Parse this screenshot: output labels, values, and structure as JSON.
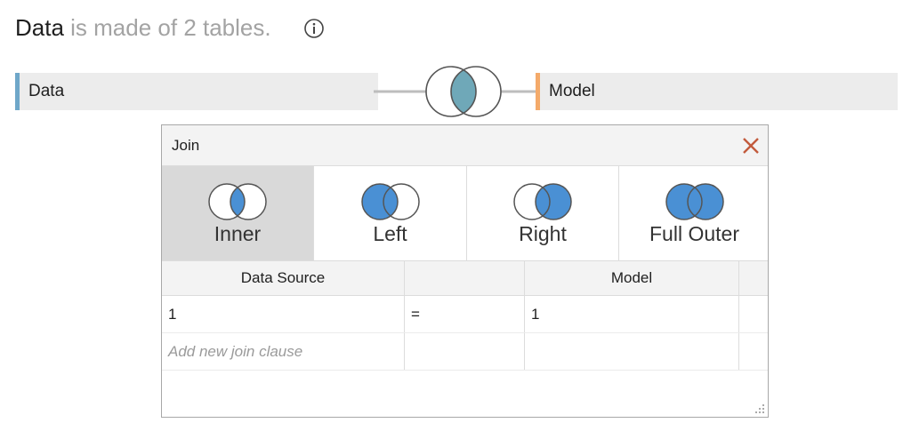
{
  "heading": {
    "source_name": "Data",
    "rest": " is made of 2 tables.",
    "info_icon": "info-circle-icon"
  },
  "tables": {
    "left": {
      "name": "Data",
      "color": "#6fa7c9"
    },
    "right": {
      "name": "Model",
      "color": "#f4aa6a"
    }
  },
  "join_dialog": {
    "title": "Join",
    "close_icon": "close-x-icon",
    "join_types": [
      {
        "label": "Inner",
        "icon": "inner-join-venn-icon",
        "selected": true
      },
      {
        "label": "Left",
        "icon": "left-join-venn-icon",
        "selected": false
      },
      {
        "label": "Right",
        "icon": "right-join-venn-icon",
        "selected": false
      },
      {
        "label": "Full Outer",
        "icon": "full-outer-join-venn-icon",
        "selected": false
      }
    ],
    "clause_headers": {
      "left": "Data Source",
      "operator": "",
      "right": "Model"
    },
    "clauses": [
      {
        "left": "1",
        "operator": "=",
        "right": "1"
      }
    ],
    "add_clause_placeholder": "Add new join clause"
  },
  "colors": {
    "venn_fill": "#4a90d4",
    "join_link_fill": "#6fa8b8",
    "close": "#c25a3c"
  }
}
